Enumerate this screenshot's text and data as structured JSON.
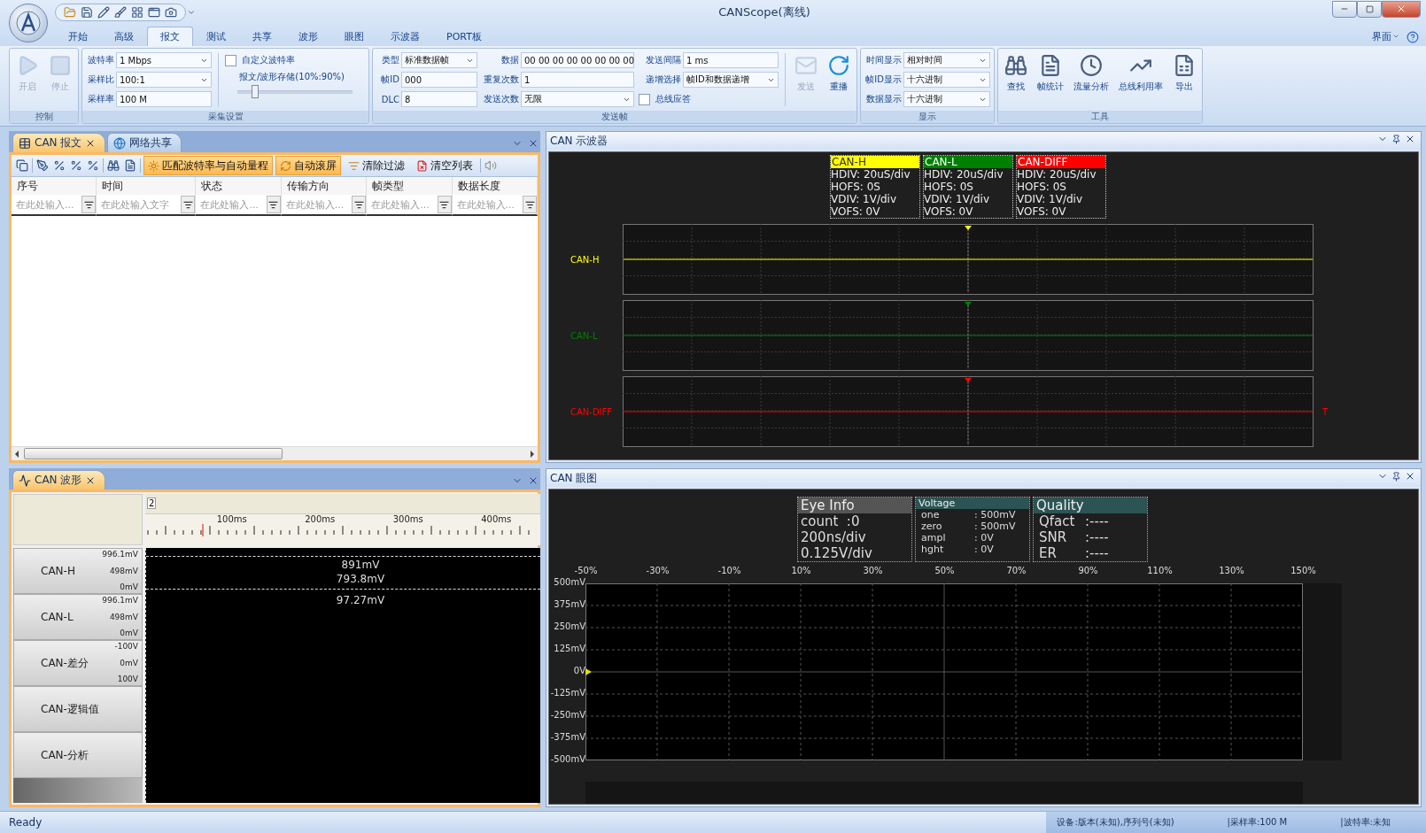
{
  "window": {
    "title": "CANScope(离线)"
  },
  "ribbon": {
    "tabs": [
      {
        "label": "开始",
        "selected": false
      },
      {
        "label": "高级",
        "selected": false
      },
      {
        "label": "报文",
        "selected": true
      },
      {
        "label": "测试",
        "selected": false
      },
      {
        "label": "共享",
        "selected": false
      },
      {
        "label": "波形",
        "selected": false
      },
      {
        "label": "眼图",
        "selected": false
      },
      {
        "label": "示波器",
        "selected": false
      },
      {
        "label": "PORT板",
        "selected": false
      }
    ],
    "menu": "界面",
    "control": {
      "caption": "控制",
      "buttons": [
        {
          "label": "开启",
          "disabled": true
        },
        {
          "label": "停止",
          "disabled": true
        }
      ]
    },
    "acquisition": {
      "caption": "采集设置",
      "fields": [
        {
          "kind": "dropdown",
          "label": "波特率",
          "value": "1 Mbps"
        },
        {
          "kind": "dropdown",
          "label": "采样比",
          "value": "100:1"
        },
        {
          "kind": "text",
          "label": "采样率",
          "value": "100 M"
        }
      ],
      "options": [
        {
          "kind": "checkbox",
          "label": "自定义波特率",
          "checked": false
        },
        {
          "kind": "slider",
          "label": "报文/波形存储(10%:90%)",
          "level": 0.12
        }
      ]
    },
    "send_frame": {
      "caption": "发送帧",
      "columns": [
        [
          {
            "kind": "dropdown",
            "label": "类型",
            "value": "标准数据帧"
          },
          {
            "kind": "text",
            "label": "帧ID",
            "value": "000"
          },
          {
            "kind": "text",
            "label": "DLC",
            "value": "8"
          }
        ],
        [
          {
            "kind": "text",
            "label": "数据",
            "value": "00 00 00 00 00 00 00 00"
          },
          {
            "kind": "text",
            "label": "重复次数",
            "value": "1"
          },
          {
            "kind": "dropdown",
            "label": "发送次数",
            "value": "无限"
          }
        ],
        [
          {
            "kind": "text",
            "label": "发送间隔",
            "value": "1 ms"
          },
          {
            "kind": "dropdown",
            "label": "递增选择",
            "value": "帧ID和数据递增"
          },
          {
            "kind": "checkbox",
            "label": "总线应答",
            "checked": false
          }
        ]
      ],
      "buttons": [
        {
          "label": "发送",
          "disabled": true
        },
        {
          "label": "重播",
          "disabled": false
        }
      ]
    },
    "display": {
      "caption": "显示",
      "fields": [
        {
          "kind": "dropdown",
          "label": "时间显示",
          "value": "相对时间"
        },
        {
          "kind": "dropdown",
          "label": "帧ID显示",
          "value": "十六进制"
        },
        {
          "kind": "dropdown",
          "label": "数据显示",
          "value": "十六进制"
        }
      ]
    },
    "tools": {
      "caption": "工具",
      "buttons": [
        {
          "label": "查找"
        },
        {
          "label": "帧统计"
        },
        {
          "label": "流量分析"
        },
        {
          "label": "总线利用率"
        },
        {
          "label": "导出"
        }
      ]
    }
  },
  "message_panel": {
    "tabs": [
      {
        "label": "CAN 报文",
        "selected": true
      },
      {
        "label": "网络共享",
        "selected": false
      }
    ],
    "toolbar": [
      {
        "label": "匹配波特率与自动量程",
        "active": true
      },
      {
        "label": "自动滚屏",
        "active": true
      },
      {
        "label": "清除过滤",
        "active": false
      },
      {
        "label": "清空列表",
        "active": false
      }
    ],
    "columns": [
      {
        "title": "序号",
        "placeholder": "在此处输入..."
      },
      {
        "title": "时间",
        "placeholder": "在此处输入文字"
      },
      {
        "title": "状态",
        "placeholder": "在此处输入..."
      },
      {
        "title": "传输方向",
        "placeholder": "在此处输入..."
      },
      {
        "title": "帧类型",
        "placeholder": "在此处输入..."
      },
      {
        "title": "数据长度",
        "placeholder": "在此处输入..."
      }
    ]
  },
  "scope_panel": {
    "title": "CAN 示波器",
    "channels": [
      {
        "legend": "CAN-H",
        "color": "#ffff00",
        "lines": [
          "HDIV: 20uS/div",
          "HOFS: 0S",
          "VDIV: 1V/div",
          "VOFS: 0V"
        ],
        "label": "CAN-H"
      },
      {
        "legend": "CAN-L",
        "color": "#008000",
        "lines": [
          "HDIV: 20uS/div",
          "HOFS: 0S",
          "VDIV: 1V/div",
          "VOFS: 0V"
        ],
        "label": "CAN-L"
      },
      {
        "legend": "CAN-DIFF",
        "color": "#ff0000",
        "lines": [
          "HDIV: 20uS/div",
          "HOFS: 0S",
          "VDIV: 1V/div",
          "VOFS: 0V"
        ],
        "label": "CAN-DIFF",
        "end_mark": "T"
      }
    ]
  },
  "wave_panel": {
    "tabs": [
      {
        "label": "CAN 波形",
        "selected": true
      }
    ],
    "marker": "2",
    "ruler": [
      "100ms",
      "200ms",
      "300ms",
      "400ms"
    ],
    "channels": [
      {
        "name": "CAN-H",
        "scale": [
          "996.1mV",
          "498mV",
          "0mV"
        ]
      },
      {
        "name": "CAN-L",
        "scale": [
          "996.1mV",
          "498mV",
          "0mV"
        ]
      },
      {
        "name": "CAN-差分",
        "scale": [
          "-100V",
          "0mV",
          "100V"
        ]
      },
      {
        "name": "CAN-逻辑值"
      },
      {
        "name": "CAN-分析"
      }
    ],
    "readings": [
      "891mV",
      "793.8mV",
      "97.27mV"
    ]
  },
  "eye_panel": {
    "title": "CAN 眼图",
    "eye_info": {
      "title": "Eye Info",
      "lines": [
        "count  :0",
        "200ns/div",
        "0.125V/div"
      ]
    },
    "voltage": {
      "title": "Voltage",
      "rows": [
        {
          "name": "one",
          "value": ": 500mV"
        },
        {
          "name": "zero",
          "value": ": 500mV"
        },
        {
          "name": "ampl",
          "value": ": 0V"
        },
        {
          "name": "hght",
          "value": ": 0V"
        }
      ]
    },
    "quality": {
      "title": "Quality",
      "rows": [
        {
          "name": "Qfact",
          "value": ":----"
        },
        {
          "name": "SNR",
          "value": ":----"
        },
        {
          "name": "ER",
          "value": ":----"
        }
      ]
    },
    "x_labels": [
      "-50%",
      "-30%",
      "-10%",
      "10%",
      "30%",
      "50%",
      "70%",
      "90%",
      "110%",
      "130%",
      "150%"
    ],
    "y_labels": [
      "500mV",
      "375mV",
      "250mV",
      "125mV",
      "0V",
      "-125mV",
      "-250mV",
      "-375mV",
      "-500mV"
    ]
  },
  "status_bar": {
    "message": "Ready",
    "fields": [
      "设备:版本(未知),序列号(未知)",
      "|采样率:100 M",
      "|波特率:未知"
    ]
  }
}
